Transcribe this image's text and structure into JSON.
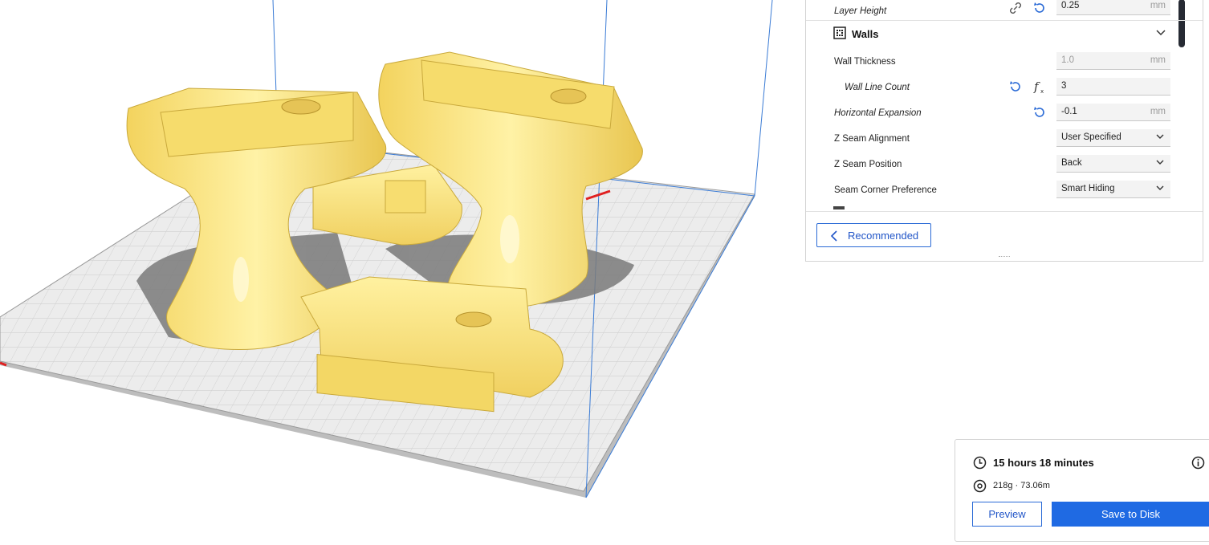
{
  "settings": {
    "layer_height": {
      "label": "Layer Height",
      "value": "0.25",
      "unit": "mm"
    },
    "walls_section": {
      "title": "Walls"
    },
    "wall_thickness": {
      "label": "Wall Thickness",
      "value": "1.0",
      "unit": "mm"
    },
    "wall_line_count": {
      "label": "Wall Line Count",
      "value": "3"
    },
    "horizontal_expansion": {
      "label": "Horizontal Expansion",
      "value": "-0.1",
      "unit": "mm"
    },
    "z_seam_alignment": {
      "label": "Z Seam Alignment",
      "value": "User Specified"
    },
    "z_seam_position": {
      "label": "Z Seam Position",
      "value": "Back"
    },
    "seam_corner_preference": {
      "label": "Seam Corner Preference",
      "value": "Smart Hiding"
    }
  },
  "recommended_label": "Recommended",
  "print_info": {
    "time": "15 hours 18 minutes",
    "material": "218g · 73.06m"
  },
  "buttons": {
    "preview": "Preview",
    "save": "Save to Disk"
  },
  "colors": {
    "accent": "#1f6ae3",
    "model": "#f7e27c",
    "build_plate": "#e4e4e4"
  }
}
